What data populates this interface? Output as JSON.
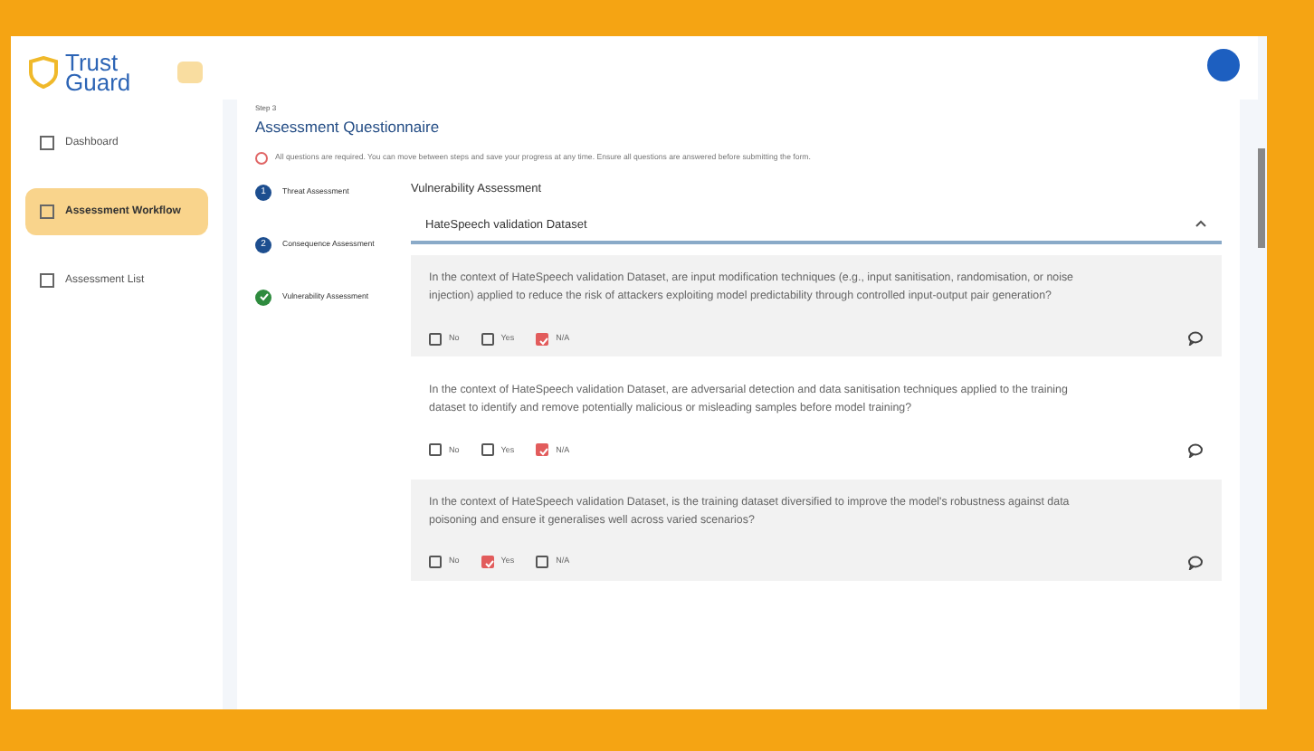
{
  "logo": {
    "line_1": "Trust",
    "line_2": "Guard"
  },
  "sidebar": {
    "items": [
      {
        "label": "Dashboard",
        "selected": false
      },
      {
        "label": "Assessment Workflow",
        "selected": true
      },
      {
        "label": "Assessment List",
        "selected": false
      }
    ]
  },
  "header": {
    "step": "Step 3",
    "title": "Assessment Questionnaire",
    "notice": "All questions are required. You can move between steps and save your progress at any time. Ensure all questions are answered before submitting the form."
  },
  "steps": [
    {
      "number": "1",
      "label": "Threat Assessment",
      "completed": false
    },
    {
      "number": "2",
      "label": "Consequence Assessment",
      "completed": false
    },
    {
      "label": "Vulnerability Assessment",
      "completed": true
    }
  ],
  "section": {
    "title": "Vulnerability Assessment",
    "accordion": {
      "title": "HateSpeech validation Dataset",
      "expanded": true
    }
  },
  "questions": [
    {
      "text": "In the context of HateSpeech validation Dataset, are input modification techniques (e.g., input sanitisation, randomisation, or noise injection) applied to reduce the risk of attackers exploiting model predictability through controlled input-output pair generation?",
      "options": [
        {
          "label": "No",
          "checked": false
        },
        {
          "label": "Yes",
          "checked": false
        },
        {
          "label": "N/A",
          "checked": true
        }
      ]
    },
    {
      "text": "In the context of HateSpeech validation Dataset, are adversarial detection and data sanitisation techniques applied to the training dataset to identify and remove potentially malicious or misleading samples before model training?",
      "options": [
        {
          "label": "No",
          "checked": false
        },
        {
          "label": "Yes",
          "checked": false
        },
        {
          "label": "N/A",
          "checked": true
        }
      ]
    },
    {
      "text": "In the context of HateSpeech validation Dataset, is the training dataset diversified to improve the model's robustness against data poisoning and ensure it generalises well across varied scenarios?",
      "options": [
        {
          "label": "No",
          "checked": false
        },
        {
          "label": "Yes",
          "checked": true
        },
        {
          "label": "N/A",
          "checked": false
        }
      ]
    }
  ]
}
